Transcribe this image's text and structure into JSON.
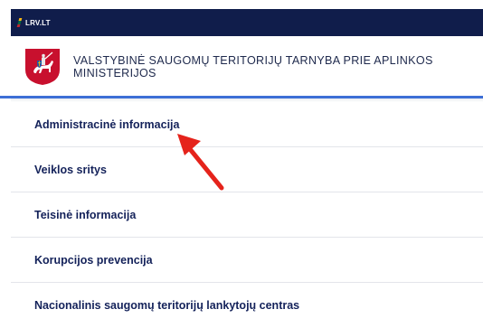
{
  "topbar": {
    "label": "LRV.LT",
    "flag_colors": [
      "#fdb913",
      "#006a44",
      "#c1272d"
    ],
    "background": "#101d4b"
  },
  "header": {
    "logo_icon": "vytis-coat-of-arms-icon",
    "agency_line1": "VALSTYBINĖ SAUGOMŲ TERITORIJŲ TARNYBA PRIE APLINKOS",
    "agency_line2": "MINISTERIJOS"
  },
  "nav": {
    "items": [
      {
        "label": "Administracinė informacija"
      },
      {
        "label": "Veiklos sritys"
      },
      {
        "label": "Teisinė informacija"
      },
      {
        "label": "Korupcijos prevencija"
      },
      {
        "label": "Nacionalinis saugomų teritorijų lankytojų centras"
      }
    ]
  },
  "annotation": {
    "icon": "red-arrow-icon",
    "color": "#e5231b"
  },
  "colors": {
    "accent": "#3d6fd6",
    "nav_text": "#14225a"
  }
}
